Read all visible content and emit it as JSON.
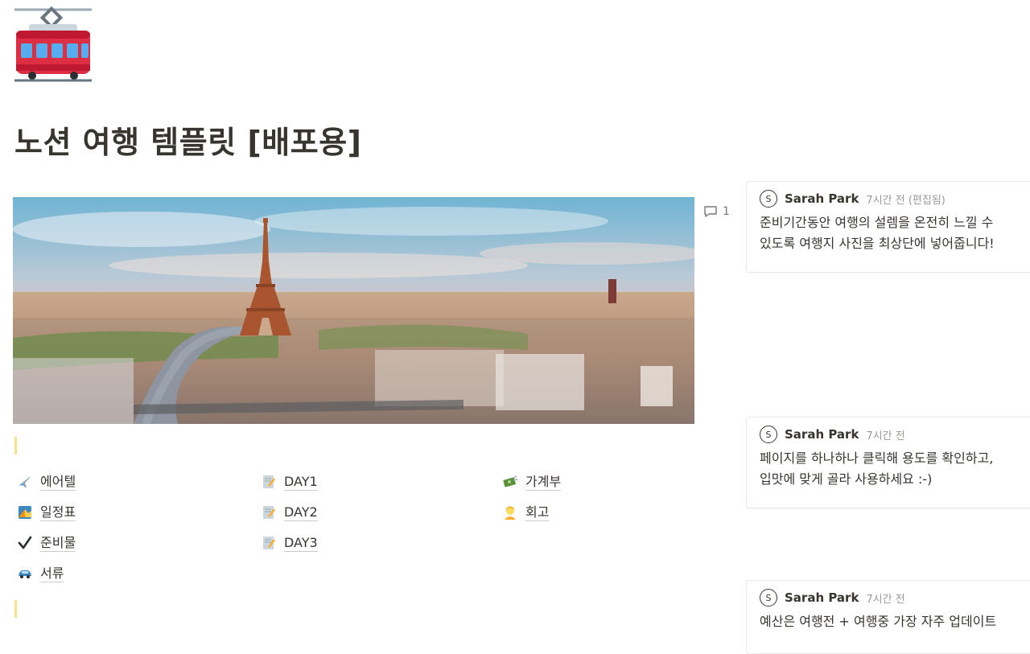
{
  "page": {
    "icon": "tram-car-icon",
    "title": "노션 여행 템플릿 [배포용]"
  },
  "cover": {
    "description": "paris-panorama"
  },
  "comment_count": "1",
  "links": [
    {
      "icon": "airplane-icon",
      "label": "에어텔"
    },
    {
      "icon": "map-icon",
      "label": "일정표"
    },
    {
      "icon": "check-icon",
      "label": "준비물"
    },
    {
      "icon": "car-icon",
      "label": "서류"
    },
    {
      "icon": "memo-icon",
      "label": "DAY1"
    },
    {
      "icon": "memo-icon",
      "label": "DAY2"
    },
    {
      "icon": "memo-icon",
      "label": "DAY3"
    },
    {
      "icon": "money-icon",
      "label": "가계부"
    },
    {
      "icon": "person-icon",
      "label": "회고"
    }
  ],
  "comments": [
    {
      "avatar": "S",
      "author": "Sarah Park",
      "time": "7시간 전 (편집됨)",
      "text": "준비기간동안 여행의 설렘을 온전히 느낄 수\n있도록 여행지 사진을 최상단에 넣어줍니다!"
    },
    {
      "avatar": "S",
      "author": "Sarah Park",
      "time": "7시간 전",
      "text": "페이지를 하나하나 클릭해 용도를 확인하고,\n입맛에 맞게 골라 사용하세요 :-)"
    },
    {
      "avatar": "S",
      "author": "Sarah Park",
      "time": "7시간 전",
      "text": "예산은 여행전 + 여행중 가장 자주 업데이트"
    }
  ],
  "colors": {
    "text": "#37352f",
    "muted": "#9b9a97",
    "highlight": "#f7e28b"
  }
}
